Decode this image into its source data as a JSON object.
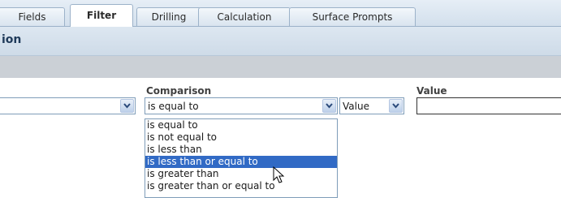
{
  "tabs": [
    {
      "label": "Fields",
      "active": false
    },
    {
      "label": "Filter",
      "active": true
    },
    {
      "label": "Drilling",
      "active": false
    },
    {
      "label": "Calculation",
      "active": false
    },
    {
      "label": "Surface Prompts",
      "active": false
    }
  ],
  "header": {
    "title": "ion"
  },
  "form": {
    "comparison_label": "Comparison",
    "value_label": "Value",
    "comparison_selected": "is equal to",
    "value_type_selected": "Value",
    "value_input": ""
  },
  "comparison_options": [
    {
      "label": "is equal to",
      "selected": false
    },
    {
      "label": "is not equal to",
      "selected": false
    },
    {
      "label": "is less than",
      "selected": false
    },
    {
      "label": "is less than or equal to",
      "selected": true
    },
    {
      "label": "is greater than",
      "selected": false
    },
    {
      "label": "is greater than or equal to",
      "selected": false
    }
  ],
  "colors": {
    "selection": "#316ac5",
    "tab_border": "#9cb2c9",
    "header_text": "#1f3a5a"
  },
  "icons": {
    "dropdown": "chevron-down-icon",
    "cursor": "mouse-pointer-icon"
  }
}
